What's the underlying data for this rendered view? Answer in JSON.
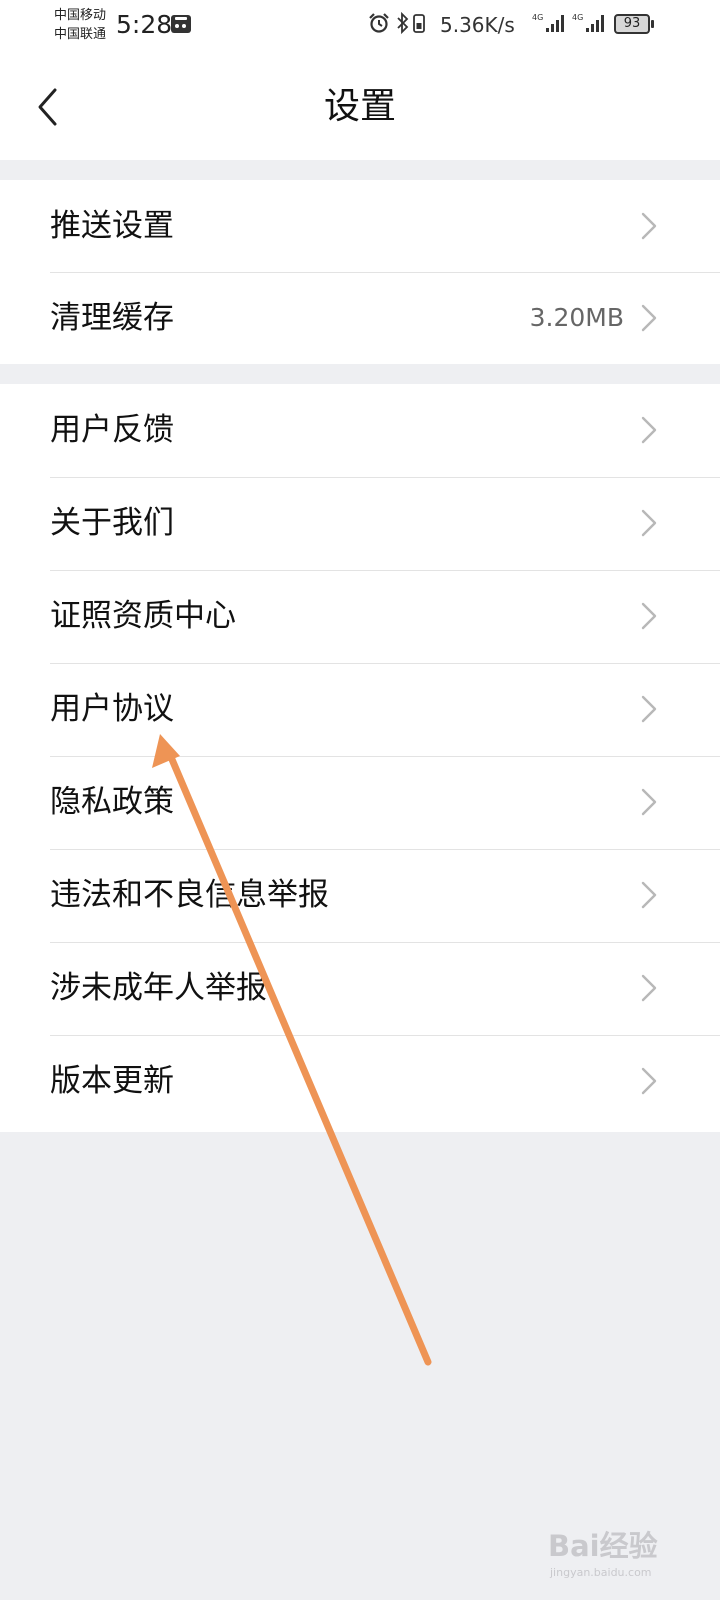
{
  "status_bar": {
    "carrier_1": "中国移动",
    "carrier_2": "中国联通",
    "time": "5:28",
    "net_speed": "5.36K/s",
    "signal_1": "4G",
    "signal_2": "4G",
    "battery": "93"
  },
  "header": {
    "title": "设置"
  },
  "group_1": [
    {
      "label": "推送设置",
      "value": ""
    },
    {
      "label": "清理缓存",
      "value": "3.20MB"
    }
  ],
  "group_2": [
    {
      "label": "用户反馈"
    },
    {
      "label": "关于我们"
    },
    {
      "label": "证照资质中心"
    },
    {
      "label": "用户协议"
    },
    {
      "label": "隐私政策"
    },
    {
      "label": "违法和不良信息举报"
    },
    {
      "label": "涉未成年人举报"
    },
    {
      "label": "版本更新"
    }
  ],
  "colors": {
    "background": "#eeeff2",
    "card": "#ffffff",
    "annotation_arrow": "#ee9455",
    "value_text": "#666666"
  },
  "watermark": {
    "brand": "Bai经验",
    "site": "jingyan.baidu.com"
  }
}
